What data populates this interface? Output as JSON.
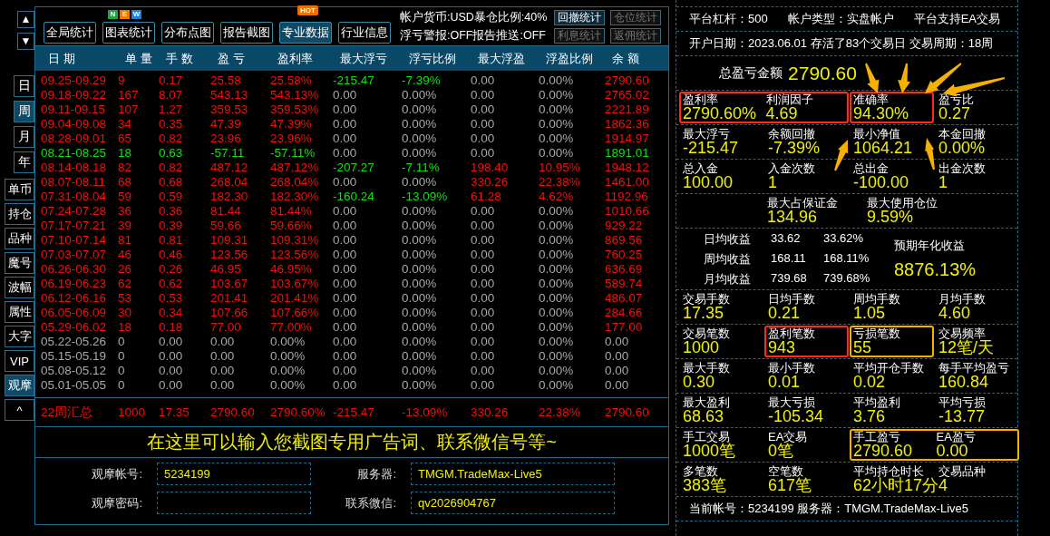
{
  "nav_buttons": [
    {
      "symbol": "▲"
    },
    {
      "symbol": "▼"
    }
  ],
  "period_tabs": [
    {
      "label": "日",
      "selected": false
    },
    {
      "label": "周",
      "selected": true
    },
    {
      "label": "月",
      "selected": false
    },
    {
      "label": "年",
      "selected": false
    }
  ],
  "view_tabs": [
    {
      "label": "单币",
      "selected": false
    },
    {
      "label": "持仓",
      "selected": false
    },
    {
      "label": "品种",
      "selected": false
    },
    {
      "label": "魔号",
      "selected": false
    },
    {
      "label": "波幅",
      "selected": false
    },
    {
      "label": "属性",
      "selected": false
    },
    {
      "label": "大字",
      "selected": false
    },
    {
      "label": "VIP",
      "selected": false
    },
    {
      "label": "观摩",
      "selected": true
    },
    {
      "label": "^",
      "selected": false
    }
  ],
  "toolbar": {
    "tabs": [
      {
        "label": "全局统计",
        "selected": false
      },
      {
        "label": "图表统计",
        "selected": false,
        "badge": {
          "kind": "new",
          "letters": [
            "N",
            "E",
            "W"
          ]
        }
      },
      {
        "label": "分布点图",
        "selected": false
      },
      {
        "label": "报告截图",
        "selected": false
      },
      {
        "label": "专业数据",
        "selected": true,
        "badge": {
          "kind": "hot",
          "letters": [
            "HOT"
          ]
        }
      },
      {
        "label": "行业信息",
        "selected": false
      }
    ],
    "info": [
      "帐户货币:USD暴仓比例:40%",
      "浮亏警报:OFF报告推送:OFF"
    ],
    "small_buttons": [
      {
        "label": "回撤统计",
        "disabled": false
      },
      {
        "label": "仓位统计",
        "disabled": true
      },
      {
        "label": "利息统计",
        "disabled": true
      },
      {
        "label": "返佣统计",
        "disabled": true
      }
    ]
  },
  "table": {
    "columns": [
      "日 期",
      "单 量",
      "手 数",
      "盈 亏",
      "盈利率",
      "最大浮亏",
      "浮亏比例",
      "最大浮盈",
      "浮盈比例",
      "余 额"
    ],
    "rows": [
      {
        "color": "#f01010",
        "drawdown": true,
        "runup": false,
        "cells": [
          "09.25-09.29",
          "9",
          "0.17",
          "25.58",
          "25.58%",
          "-215.47",
          "-7.39%",
          "0.00",
          "0.00%",
          "2790.60"
        ]
      },
      {
        "color": "#f01010",
        "drawdown": false,
        "runup": false,
        "cells": [
          "09.18-09.22",
          "167",
          "8.07",
          "543.13",
          "543.13%",
          "0.00",
          "0.00%",
          "0.00",
          "0.00%",
          "2765.02"
        ]
      },
      {
        "color": "#f01010",
        "drawdown": false,
        "runup": false,
        "cells": [
          "09.11-09.15",
          "107",
          "1.27",
          "359.53",
          "359.53%",
          "0.00",
          "0.00%",
          "0.00",
          "0.00%",
          "2221.89"
        ]
      },
      {
        "color": "#f01010",
        "drawdown": false,
        "runup": false,
        "cells": [
          "09.04-09.08",
          "34",
          "0.35",
          "47.39",
          "47.39%",
          "0.00",
          "0.00%",
          "0.00",
          "0.00%",
          "1862.36"
        ]
      },
      {
        "color": "#f01010",
        "drawdown": false,
        "runup": false,
        "cells": [
          "08.28-09.01",
          "65",
          "0.82",
          "23.96",
          "23.96%",
          "0.00",
          "0.00%",
          "0.00",
          "0.00%",
          "1914.97"
        ]
      },
      {
        "color": "#10e010",
        "drawdown": false,
        "runup": false,
        "cells": [
          "08.21-08.25",
          "18",
          "0.63",
          "-57.11",
          "-57.11%",
          "0.00",
          "0.00%",
          "0.00",
          "0.00%",
          "1891.01"
        ]
      },
      {
        "color": "#f01010",
        "drawdown": true,
        "runup": true,
        "cells": [
          "08.14-08.18",
          "82",
          "0.82",
          "487.12",
          "487.12%",
          "-207.27",
          "-7.11%",
          "198.40",
          "10.95%",
          "1948.12"
        ]
      },
      {
        "color": "#f01010",
        "drawdown": false,
        "runup": true,
        "cells": [
          "08.07-08.11",
          "68",
          "0.68",
          "268.04",
          "268.04%",
          "0.00",
          "0.00%",
          "330.26",
          "22.38%",
          "1461.00"
        ]
      },
      {
        "color": "#f01010",
        "drawdown": true,
        "runup": true,
        "cells": [
          "07.31-08.04",
          "59",
          "0.59",
          "182.30",
          "182.30%",
          "-160.24",
          "-13.09%",
          "61.28",
          "4.62%",
          "1192.96"
        ]
      },
      {
        "color": "#f01010",
        "drawdown": false,
        "runup": false,
        "cells": [
          "07.24-07.28",
          "36",
          "0.36",
          "81.44",
          "81.44%",
          "0.00",
          "0.00%",
          "0.00",
          "0.00%",
          "1010.66"
        ]
      },
      {
        "color": "#f01010",
        "drawdown": false,
        "runup": false,
        "cells": [
          "07.17-07.21",
          "39",
          "0.39",
          "59.66",
          "59.66%",
          "0.00",
          "0.00%",
          "0.00",
          "0.00%",
          "929.22"
        ]
      },
      {
        "color": "#f01010",
        "drawdown": false,
        "runup": false,
        "cells": [
          "07.10-07.14",
          "81",
          "0.81",
          "109.31",
          "109.31%",
          "0.00",
          "0.00%",
          "0.00",
          "0.00%",
          "869.56"
        ]
      },
      {
        "color": "#f01010",
        "drawdown": false,
        "runup": false,
        "cells": [
          "07.03-07.07",
          "46",
          "0.46",
          "123.56",
          "123.56%",
          "0.00",
          "0.00%",
          "0.00",
          "0.00%",
          "760.25"
        ]
      },
      {
        "color": "#f01010",
        "drawdown": false,
        "runup": false,
        "cells": [
          "06.26-06.30",
          "26",
          "0.26",
          "46.95",
          "46.95%",
          "0.00",
          "0.00%",
          "0.00",
          "0.00%",
          "636.69"
        ]
      },
      {
        "color": "#f01010",
        "drawdown": false,
        "runup": false,
        "cells": [
          "06.19-06.23",
          "62",
          "0.62",
          "103.67",
          "103.67%",
          "0.00",
          "0.00%",
          "0.00",
          "0.00%",
          "589.74"
        ]
      },
      {
        "color": "#f01010",
        "drawdown": false,
        "runup": false,
        "cells": [
          "06.12-06.16",
          "53",
          "0.53",
          "201.41",
          "201.41%",
          "0.00",
          "0.00%",
          "0.00",
          "0.00%",
          "486.07"
        ]
      },
      {
        "color": "#f01010",
        "drawdown": false,
        "runup": false,
        "cells": [
          "06.05-06.09",
          "30",
          "0.34",
          "107.66",
          "107.66%",
          "0.00",
          "0.00%",
          "0.00",
          "0.00%",
          "284.66"
        ]
      },
      {
        "color": "#f01010",
        "drawdown": false,
        "runup": false,
        "cells": [
          "05.29-06.02",
          "18",
          "0.18",
          "77.00",
          "77.00%",
          "0.00",
          "0.00%",
          "0.00",
          "0.00%",
          "177.00"
        ]
      },
      {
        "color": "#a8a8a8",
        "drawdown": false,
        "runup": false,
        "cells": [
          "05.22-05.26",
          "0",
          "0.00",
          "0.00",
          "0.00%",
          "0.00",
          "0.00%",
          "0.00",
          "0.00%",
          "0.00"
        ]
      },
      {
        "color": "#a8a8a8",
        "drawdown": false,
        "runup": false,
        "cells": [
          "05.15-05.19",
          "0",
          "0.00",
          "0.00",
          "0.00%",
          "0.00",
          "0.00%",
          "0.00",
          "0.00%",
          "0.00"
        ]
      },
      {
        "color": "#a8a8a8",
        "drawdown": false,
        "runup": false,
        "cells": [
          "05.08-05.12",
          "0",
          "0.00",
          "0.00",
          "0.00%",
          "0.00",
          "0.00%",
          "0.00",
          "0.00%",
          "0.00"
        ]
      },
      {
        "color": "#a8a8a8",
        "drawdown": false,
        "runup": false,
        "cells": [
          "05.01-05.05",
          "0",
          "0.00",
          "0.00",
          "0.00%",
          "0.00",
          "0.00%",
          "0.00",
          "0.00%",
          "0.00"
        ]
      }
    ],
    "summary": {
      "cells": [
        "22周汇总",
        "1000",
        "17.35",
        "2790.60",
        "2790.60%",
        "-215.47",
        "-13.09%",
        "330.26",
        "22.38%",
        "2790.60"
      ]
    }
  },
  "banner": "在这里可以输入您截图专用广告词、联系微信号等~",
  "form": [
    {
      "label": "观摩帐号:",
      "value": "5234199"
    },
    {
      "label": "服务器:",
      "value": "TMGM.TradeMax-Live5"
    },
    {
      "label": "观摩密码:"
    },
    {
      "label": "联系微信:",
      "value": "qv2026904767"
    }
  ],
  "stats": [
    {
      "kind": "line",
      "texts": [
        "平台杠杆：500",
        "帐户类型：实盘帐户",
        "平台支持EA交易"
      ]
    },
    {
      "kind": "line",
      "texts": [
        "开户日期：2023.06.01 存活了83个交易日  交易周期：18周"
      ]
    },
    {
      "kind": "total",
      "label": "总盈亏金额",
      "value": "2790.60"
    },
    {
      "kind": "grid",
      "cells": [
        {
          "label": "盈利率",
          "value": "2790.60%",
          "framed": true,
          "color": "#ff2a1a"
        },
        {
          "label": "利润因子",
          "value": "4.69",
          "frame_joins": true
        },
        {
          "label": "准确率",
          "value": "94.30%",
          "framed": true,
          "color": "#ff2a1a"
        },
        {
          "label": "盈亏比",
          "value": "0.27"
        }
      ]
    },
    {
      "kind": "grid",
      "cells": [
        {
          "label": "最大浮亏",
          "value": "-215.47"
        },
        {
          "label": "余额回撤",
          "value": "-7.39%"
        },
        {
          "label": "最小净值",
          "value": "1064.21"
        },
        {
          "label": "本金回撤",
          "value": "0.00%"
        }
      ]
    },
    {
      "kind": "grid",
      "cells": [
        {
          "label": "总入金",
          "value": "100.00"
        },
        {
          "label": "入金次数",
          "value": "1"
        },
        {
          "label": "总出金",
          "value": "-100.00"
        },
        {
          "label": "出金次数",
          "value": "1"
        }
      ]
    },
    {
      "kind": "center",
      "cells": [
        {
          "label": "最大占保证金",
          "value": "134.96"
        },
        {
          "label": "最大使用仓位",
          "value": "9.59%"
        }
      ]
    },
    {
      "kind": "income",
      "rows": [
        {
          "label": "日均收益",
          "amount": "33.62",
          "percent": "33.62%"
        },
        {
          "label": "周均收益",
          "amount": "168.11",
          "percent": "168.11%"
        },
        {
          "label": "月均收益",
          "amount": "739.68",
          "percent": "739.68%"
        }
      ],
      "side": {
        "label": "预期年化收益",
        "value": "8876.13%"
      }
    },
    {
      "kind": "grid",
      "cells": [
        {
          "label": "交易手数",
          "value": "17.35"
        },
        {
          "label": "日均手数",
          "value": "0.21"
        },
        {
          "label": "周均手数",
          "value": "1.05"
        },
        {
          "label": "月均手数",
          "value": "4.60"
        }
      ]
    },
    {
      "kind": "grid",
      "cells": [
        {
          "label": "交易笔数",
          "value": "1000"
        },
        {
          "label": "盈利笔数",
          "value": "943",
          "framed": true,
          "color": "#ff2a1a"
        },
        {
          "label": "亏损笔数",
          "value": "55",
          "framed": true,
          "color": "#f5b000"
        },
        {
          "label": "交易频率",
          "value": "12笔/天"
        }
      ]
    },
    {
      "kind": "grid",
      "cells": [
        {
          "label": "最大手数",
          "value": "0.30"
        },
        {
          "label": "最小手数",
          "value": "0.01"
        },
        {
          "label": "平均开仓手数",
          "value": "0.02"
        },
        {
          "label": "每手平均盈亏",
          "value": "160.84"
        }
      ]
    },
    {
      "kind": "grid",
      "cells": [
        {
          "label": "最大盈利",
          "value": "68.63"
        },
        {
          "label": "最大亏损",
          "value": "-105.34"
        },
        {
          "label": "平均盈利",
          "value": "3.76"
        },
        {
          "label": "平均亏损",
          "value": "-13.77"
        }
      ]
    },
    {
      "kind": "grid",
      "cells": [
        {
          "label": "手工交易",
          "value": "1000笔"
        },
        {
          "label": "EA交易",
          "value": "0笔"
        },
        {
          "label": "手工盈亏",
          "value": "2790.60",
          "framed": true,
          "color": "#f5b000"
        },
        {
          "label": "EA盈亏",
          "value": "0.00",
          "frame_joins": true
        }
      ]
    },
    {
      "kind": "grid",
      "cells": [
        {
          "label": "多笔数",
          "value": "383笔"
        },
        {
          "label": "空笔数",
          "value": "617笔"
        },
        {
          "label": "平均持仓时长",
          "value": "62小时17分"
        },
        {
          "label": "交易品种",
          "value": "4"
        }
      ]
    },
    {
      "kind": "line",
      "texts": [
        "当前帐号：5234199 服务器：TMGM.TradeMax-Live5"
      ]
    }
  ]
}
